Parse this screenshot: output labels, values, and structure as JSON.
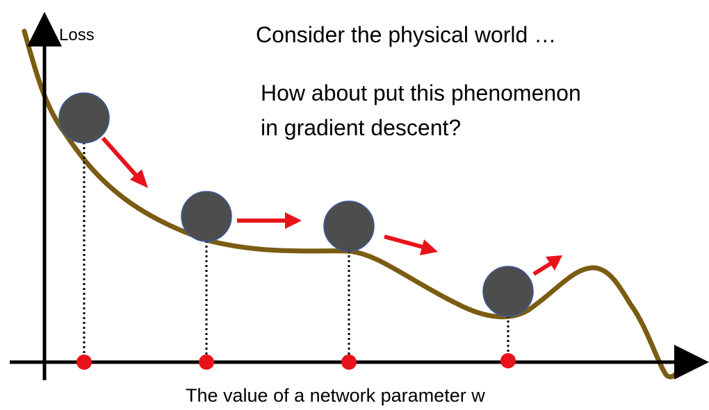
{
  "axes": {
    "y_label": "Loss",
    "x_label": "The value of a network parameter w"
  },
  "text": {
    "headline": "Consider the physical world …",
    "question_line1": "How about put this phenomenon",
    "question_line2": "in gradient descent?"
  },
  "colors": {
    "curve": "#7a5c12",
    "ball": "#4d4d4d",
    "ball_outline": "#3b5a9e",
    "arrow": "#e8131a",
    "axis_point": "#e8131a",
    "axis": "#000000"
  },
  "balls": [
    {
      "id": 1,
      "moving": "down-right"
    },
    {
      "id": 2,
      "moving": "right"
    },
    {
      "id": 3,
      "moving": "down-right"
    },
    {
      "id": 4,
      "moving": "up-right"
    }
  ]
}
